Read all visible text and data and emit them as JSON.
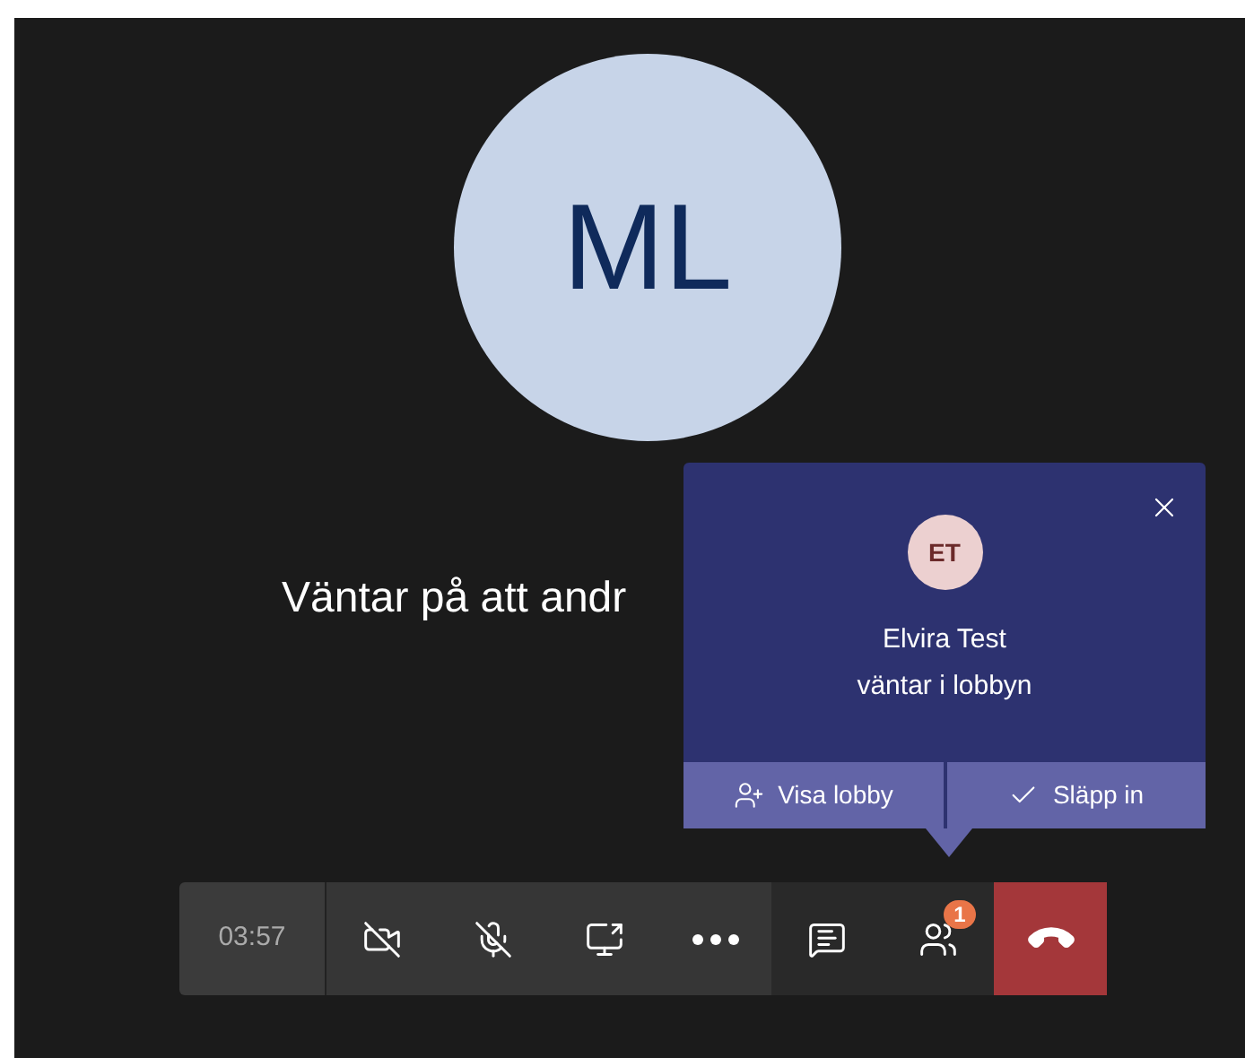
{
  "participant": {
    "initials": "ML"
  },
  "status_text": "Väntar på att andr",
  "lobby_notification": {
    "initials": "ET",
    "name": "Elvira Test",
    "message": "väntar i lobbyn",
    "actions": [
      {
        "kind": "lobby",
        "label": "Visa lobby"
      },
      {
        "kind": "admit",
        "label": "Släpp in"
      }
    ]
  },
  "toolbar": {
    "timer": "03:57",
    "controls": [
      {
        "kind": "camera"
      },
      {
        "kind": "mic"
      },
      {
        "kind": "share"
      },
      {
        "kind": "more"
      },
      {
        "kind": "chat"
      },
      {
        "kind": "people",
        "badge": "1"
      },
      {
        "kind": "hangup"
      }
    ]
  }
}
